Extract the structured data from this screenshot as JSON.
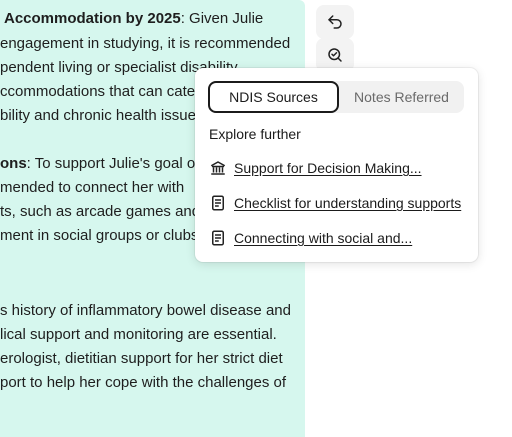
{
  "document": {
    "lines": [
      {
        "bold": "Accommodation by 2025",
        "text": ": Given Julie"
      },
      {
        "bold": "",
        "text": "engagement in studying, it is recommended"
      },
      {
        "bold": "",
        "text": "pendent living or specialist disability"
      },
      {
        "bold": "",
        "text": "ccommodations that can cater"
      },
      {
        "bold": "",
        "text": "bility and chronic health issue"
      },
      {
        "bold": "ons",
        "text": ": To support Julie's goal of"
      },
      {
        "bold": "",
        "text": "mended to connect her with"
      },
      {
        "bold": "",
        "text": "ts, such as arcade games and"
      },
      {
        "bold": "",
        "text": "ment in social groups or clubs"
      },
      {
        "bold": "",
        "text": "s history of inflammatory bowel disease and"
      },
      {
        "bold": "",
        "text": "lical support and monitoring are essential."
      },
      {
        "bold": "",
        "text": "erologist, dietitian support for her strict diet"
      },
      {
        "bold": "",
        "text": "port to help her cope with the challenges of"
      }
    ]
  },
  "toolbar": {
    "undo_icon": "undo-icon",
    "zoom_icon": "search-check-icon"
  },
  "popover": {
    "tabs": [
      {
        "label": "NDIS Sources",
        "active": true
      },
      {
        "label": "Notes Referred",
        "active": false
      }
    ],
    "explore_label": "Explore further",
    "items": [
      {
        "icon": "bank-icon",
        "label": "Support for Decision Making..."
      },
      {
        "icon": "document-icon",
        "label": "Checklist for understanding supports"
      },
      {
        "icon": "document-icon",
        "label": "Connecting with social and..."
      }
    ]
  }
}
